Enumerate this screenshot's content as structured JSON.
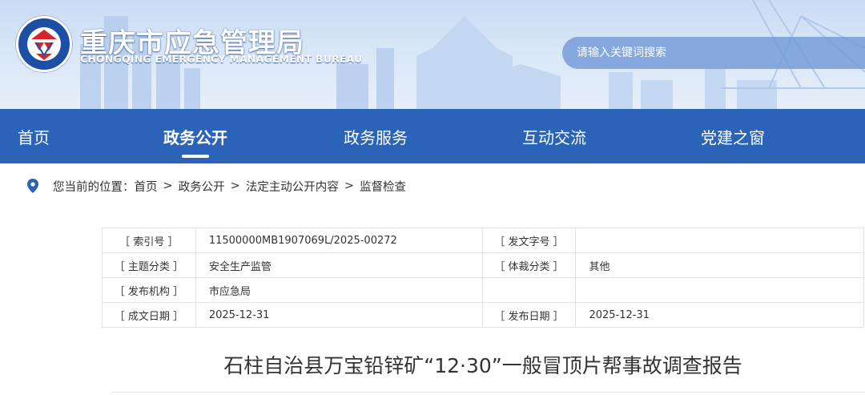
{
  "header": {
    "title": "重庆市应急管理局",
    "subtitle": "CHONGQING EMERGENCY MANAGEMENT BUREAU",
    "logo_icon": "emergency-badge-icon",
    "search": {
      "placeholder": "请输入关键词搜索"
    }
  },
  "nav": {
    "items": [
      {
        "label": "首页",
        "active": false
      },
      {
        "label": "政务公开",
        "active": true
      },
      {
        "label": "政务服务",
        "active": false
      },
      {
        "label": "互动交流",
        "active": false
      },
      {
        "label": "党建之窗",
        "active": false
      }
    ]
  },
  "breadcrumb": {
    "prefix": "您当前的位置：",
    "separator": ">",
    "items": [
      "首页",
      "政务公开",
      "法定主动公开内容",
      "监督检查"
    ]
  },
  "meta": {
    "rows": [
      {
        "k1": "［ 索引号 ］",
        "v1": "11500000MB1907069L/2025-00272",
        "k2": "［ 发文字号 ］",
        "v2": ""
      },
      {
        "k1": "［ 主题分类 ］",
        "v1": "安全生产监管",
        "k2": "［ 体裁分类 ］",
        "v2": "其他"
      },
      {
        "k1": "［ 发布机构 ］",
        "v1": "市应急局",
        "k2": "",
        "v2": ""
      },
      {
        "k1": "［ 成文日期 ］",
        "v1": "2025-12-31",
        "k2": "［ 发布日期 ］",
        "v2": "2025-12-31"
      }
    ]
  },
  "document": {
    "title": "石柱自治县万宝铅锌矿“12·30”一般冒顶片帮事故调查报告"
  },
  "colors": {
    "nav_bg": "#2a63b8",
    "logo_blue": "#1c4fa6",
    "logo_red": "#d7262b",
    "pin_blue": "#2a63b8"
  }
}
